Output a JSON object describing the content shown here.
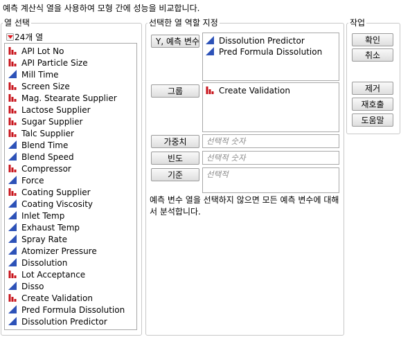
{
  "instruction": "예측 계산식 열을 사용하여 모형 간에 성능을 비교합니다.",
  "columns_panel": {
    "legend": "열 선택",
    "count_label": "24개 열",
    "items": [
      {
        "label": "API Lot No",
        "type": "nominal",
        "icon": "nominal-bar-icon"
      },
      {
        "label": "API Particle Size",
        "type": "nominal",
        "icon": "nominal-bar-icon"
      },
      {
        "label": "Mill Time",
        "type": "continuous",
        "icon": "continuous-triangle-icon"
      },
      {
        "label": "Screen Size",
        "type": "nominal",
        "icon": "nominal-bar-icon"
      },
      {
        "label": "Mag. Stearate Supplier",
        "type": "nominal",
        "icon": "nominal-bar-icon"
      },
      {
        "label": "Lactose Supplier",
        "type": "nominal",
        "icon": "nominal-bar-icon"
      },
      {
        "label": "Sugar Supplier",
        "type": "nominal",
        "icon": "nominal-bar-icon"
      },
      {
        "label": "Talc Supplier",
        "type": "nominal",
        "icon": "nominal-bar-icon"
      },
      {
        "label": "Blend Time",
        "type": "continuous",
        "icon": "continuous-triangle-icon"
      },
      {
        "label": "Blend Speed",
        "type": "continuous",
        "icon": "continuous-triangle-icon"
      },
      {
        "label": "Compressor",
        "type": "nominal",
        "icon": "nominal-bar-icon"
      },
      {
        "label": "Force",
        "type": "continuous",
        "icon": "continuous-triangle-icon"
      },
      {
        "label": "Coating Supplier",
        "type": "nominal",
        "icon": "nominal-bar-icon"
      },
      {
        "label": "Coating Viscosity",
        "type": "continuous",
        "icon": "continuous-triangle-icon"
      },
      {
        "label": "Inlet Temp",
        "type": "continuous",
        "icon": "continuous-triangle-icon"
      },
      {
        "label": "Exhaust Temp",
        "type": "continuous",
        "icon": "continuous-triangle-icon"
      },
      {
        "label": "Spray Rate",
        "type": "continuous",
        "icon": "continuous-triangle-icon"
      },
      {
        "label": "Atomizer Pressure",
        "type": "continuous",
        "icon": "continuous-triangle-icon"
      },
      {
        "label": "Dissolution",
        "type": "continuous",
        "icon": "continuous-triangle-icon"
      },
      {
        "label": "Lot Acceptance",
        "type": "nominal",
        "icon": "nominal-bar-icon"
      },
      {
        "label": "Disso",
        "type": "continuous",
        "icon": "continuous-triangle-icon"
      },
      {
        "label": "Create Validation",
        "type": "nominal",
        "icon": "nominal-bar-icon"
      },
      {
        "label": "Pred Formula Dissolution",
        "type": "continuous",
        "icon": "continuous-triangle-icon"
      },
      {
        "label": "Dissolution Predictor",
        "type": "continuous",
        "icon": "continuous-triangle-icon"
      }
    ]
  },
  "roles_panel": {
    "legend": "선택한 열 역할 지정",
    "y_button": "Y, 예측 변수",
    "y_items": [
      {
        "label": "Dissolution Predictor",
        "type": "continuous",
        "icon": "continuous-triangle-icon"
      },
      {
        "label": "Pred Formula Dissolution",
        "type": "continuous",
        "icon": "continuous-triangle-icon"
      }
    ],
    "group_button": "그룹",
    "group_items": [
      {
        "label": "Create Validation",
        "type": "nominal",
        "icon": "nominal-bar-icon"
      }
    ],
    "weight_button": "가중치",
    "weight_placeholder": "선택적 숫자",
    "freq_button": "빈도",
    "freq_placeholder": "선택적 숫자",
    "by_button": "기준",
    "by_placeholder": "선택적",
    "note": "예측 변수 열을 선택하지 않으면 모든 예측 변수에 대해서 분석합니다."
  },
  "action_panel": {
    "legend": "작업",
    "ok": "확인",
    "cancel": "취소",
    "remove": "제거",
    "recall": "재호출",
    "help": "도움말"
  },
  "colors": {
    "nominal_icon": "#c8141c",
    "continuous_icon": "#2d52b8",
    "dropdown_triangle": "#e0141c",
    "border": "#a7a7a7"
  }
}
